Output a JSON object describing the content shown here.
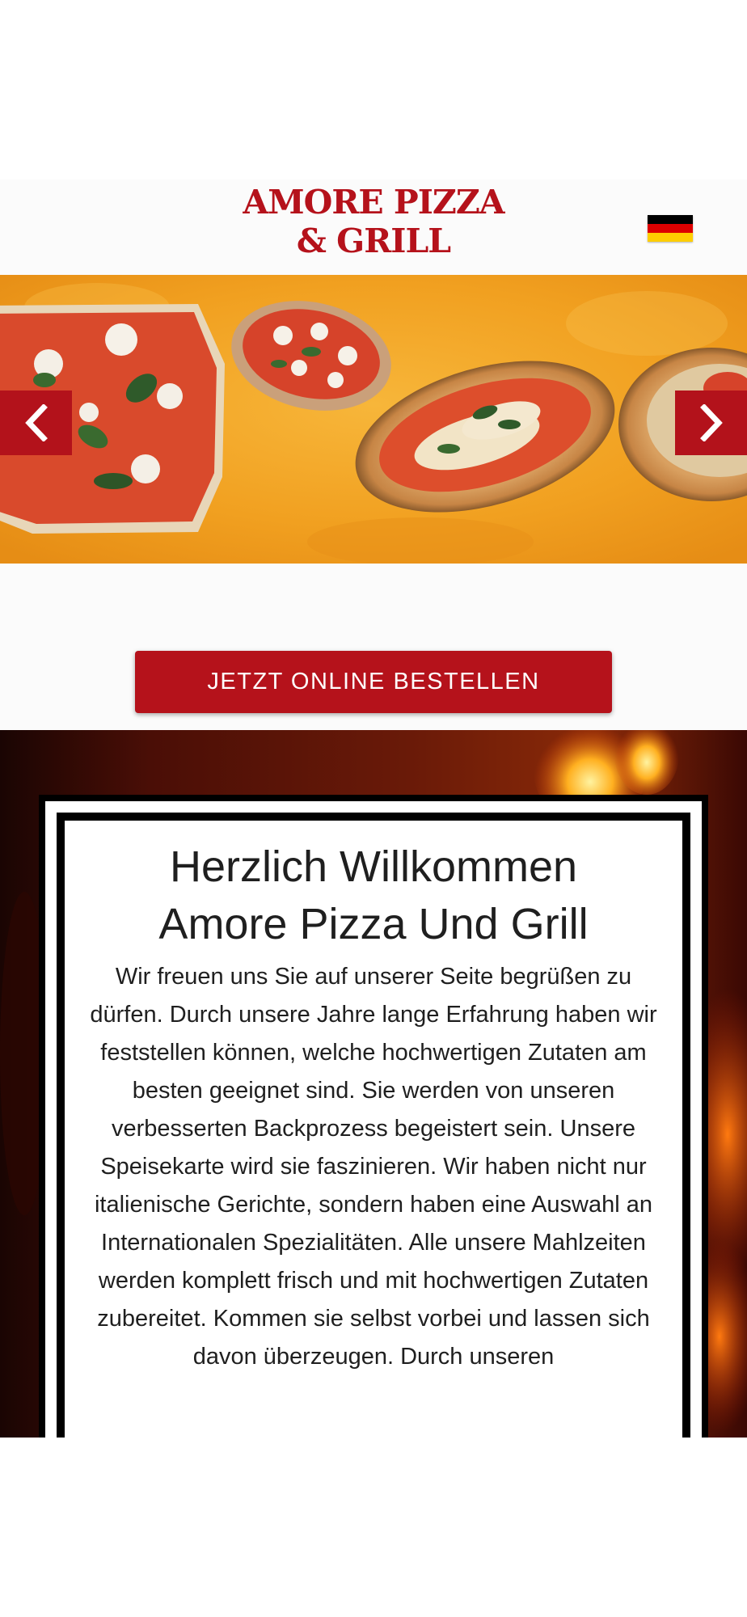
{
  "header": {
    "logo_line1": "AMORE PIZZA",
    "logo_line2": "& GRILL",
    "language_flag": "german-flag-icon",
    "flag_colors": [
      "#000000",
      "#dd0000",
      "#ffce00"
    ]
  },
  "carousel": {
    "prev_icon": "chevron-left-icon",
    "next_icon": "chevron-right-icon"
  },
  "cta": {
    "label": "JETZT ONLINE BESTELLEN"
  },
  "welcome": {
    "title_line1": "Herzlich Willkommen",
    "title_line2": "Amore Pizza Und Grill",
    "text": "Wir freuen uns Sie auf unserer Seite begrüßen zu dürfen. Durch unsere Jahre lange Erfahrung haben wir feststellen können, welche hochwertigen Zutaten am besten geeignet sind. Sie werden von unseren verbesserten Backprozess begeistert sein. Unsere Speisekarte wird sie faszinieren. Wir haben nicht nur italienische Gerichte, sondern haben eine Auswahl an Internationalen Spezialitäten. Alle unsere Mahlzeiten werden komplett frisch und mit hochwertigen Zutaten zubereitet. Kommen sie selbst vorbei und lassen sich davon überzeugen. Durch unseren"
  },
  "colors": {
    "brand_red": "#b5121b",
    "banner_orange": "#f2a11f"
  }
}
